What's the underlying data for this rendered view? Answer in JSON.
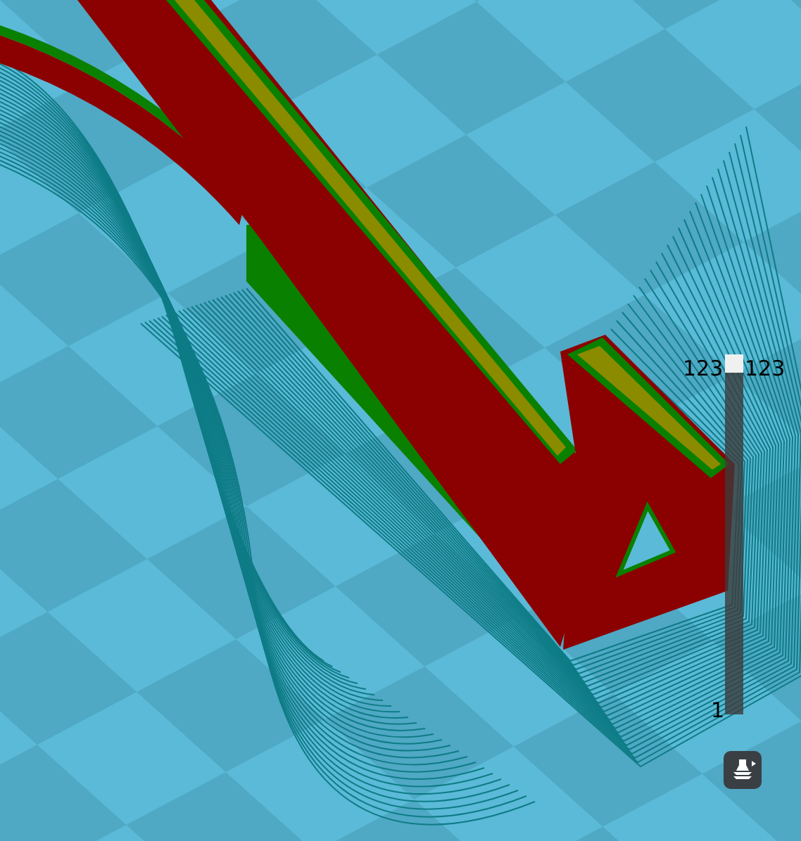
{
  "layer_slider": {
    "upper_left_label": "123",
    "upper_right_label": "123",
    "lower_label": "1",
    "level": 1
  }
}
